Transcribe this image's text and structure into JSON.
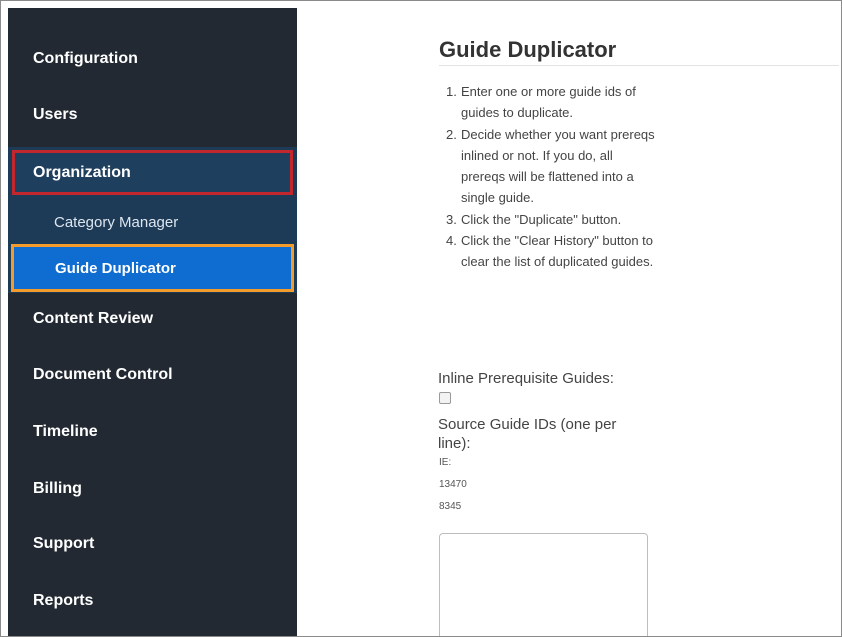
{
  "sidebar": {
    "items": [
      {
        "label": "Configuration"
      },
      {
        "label": "Users"
      },
      {
        "label": "Organization"
      },
      {
        "label": "Content Review"
      },
      {
        "label": "Document Control"
      },
      {
        "label": "Timeline"
      },
      {
        "label": "Billing"
      },
      {
        "label": "Support"
      },
      {
        "label": "Reports"
      }
    ],
    "sub_items": [
      {
        "label": "Category Manager"
      },
      {
        "label": "Guide Duplicator"
      }
    ]
  },
  "main": {
    "title": "Guide Duplicator",
    "steps": [
      {
        "num": "1.",
        "text": "Enter one or more guide ids of guides to duplicate."
      },
      {
        "num": "2.",
        "text": "Decide whether you want prereqs inlined or not. If you do, all prereqs will be flattened into a single guide."
      },
      {
        "num": "3.",
        "text": "Click the \"Duplicate\" button."
      },
      {
        "num": "4.",
        "text": "Click the \"Clear History\" button to clear the list of duplicated guides."
      }
    ],
    "inline_label": "Inline Prerequisite Guides:",
    "source_label": "Source Guide IDs (one per line):",
    "hint_lines": [
      "IE:",
      "13470",
      "8345"
    ],
    "source_value": ""
  },
  "colors": {
    "sidebar_bg": "#222932",
    "highlight_red": "#c1272d",
    "highlight_orange": "#f39c2b",
    "active_blue": "#0f6cd1"
  }
}
